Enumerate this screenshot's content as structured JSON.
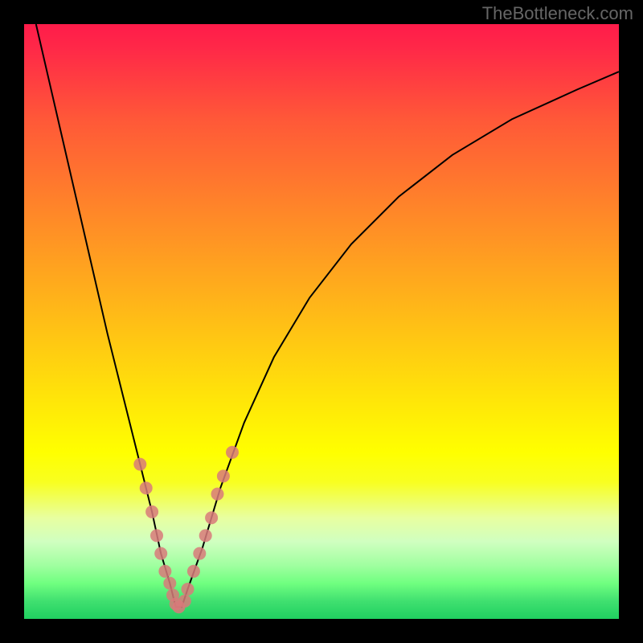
{
  "watermark": "TheBottleneck.com",
  "chart_data": {
    "type": "line",
    "title": "",
    "xlabel": "",
    "ylabel": "",
    "xlim": [
      0,
      100
    ],
    "ylim": [
      0,
      100
    ],
    "series": [
      {
        "name": "bottleneck-curve",
        "x": [
          2,
          5,
          8,
          11,
          14,
          17,
          19.5,
          21.5,
          23,
          24.5,
          25.5,
          26.5,
          27.5,
          30,
          33,
          37,
          42,
          48,
          55,
          63,
          72,
          82,
          93,
          100
        ],
        "y": [
          100,
          87,
          74,
          61,
          48,
          36,
          26,
          18,
          11,
          6,
          2,
          2,
          5,
          12,
          22,
          33,
          44,
          54,
          63,
          71,
          78,
          84,
          89,
          92
        ]
      }
    ],
    "markers": {
      "left_branch": [
        {
          "x": 19.5,
          "y": 26
        },
        {
          "x": 20.5,
          "y": 22
        },
        {
          "x": 21.5,
          "y": 18
        },
        {
          "x": 22.3,
          "y": 14
        },
        {
          "x": 23,
          "y": 11
        },
        {
          "x": 23.7,
          "y": 8
        },
        {
          "x": 24.5,
          "y": 6
        },
        {
          "x": 25,
          "y": 4
        },
        {
          "x": 25.5,
          "y": 2.5
        },
        {
          "x": 26,
          "y": 2
        }
      ],
      "right_branch": [
        {
          "x": 27,
          "y": 3
        },
        {
          "x": 27.5,
          "y": 5
        },
        {
          "x": 28.5,
          "y": 8
        },
        {
          "x": 29.5,
          "y": 11
        },
        {
          "x": 30.5,
          "y": 14
        },
        {
          "x": 31.5,
          "y": 17
        },
        {
          "x": 32.5,
          "y": 21
        },
        {
          "x": 33.5,
          "y": 24
        },
        {
          "x": 35,
          "y": 28
        }
      ]
    },
    "background_gradient": {
      "top": "#ff1c4a",
      "middle": "#ffff00",
      "bottom": "#20d060"
    }
  }
}
